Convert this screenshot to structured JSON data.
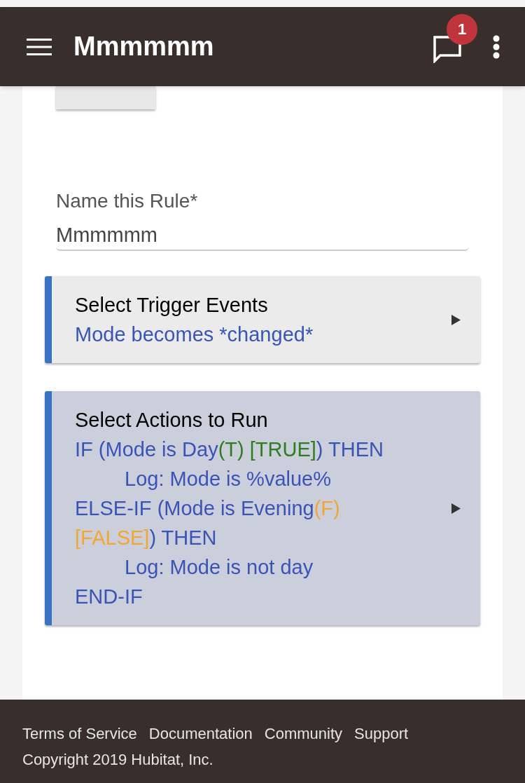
{
  "header": {
    "title": "Mmmmmm",
    "notification_count": "1"
  },
  "name_field": {
    "label": "Name this Rule*",
    "value": "Mmmmmm"
  },
  "sections": [
    {
      "title": "Select Trigger Events",
      "highlighted": false,
      "lines": [
        {
          "indented": false,
          "segments": [
            {
              "text": "Mode becomes *changed*",
              "color": "#3a53b8"
            }
          ]
        }
      ]
    },
    {
      "title": "Select Actions to Run",
      "highlighted": true,
      "lines": [
        {
          "indented": false,
          "segments": [
            {
              "text": "IF (Mode is Day",
              "color": "#3a53b8"
            },
            {
              "text": "(T) [TRUE]",
              "color": "#2e7d1f"
            },
            {
              "text": ") THEN",
              "color": "#3a53b8"
            }
          ]
        },
        {
          "indented": true,
          "segments": [
            {
              "text": "Log: Mode is %value%",
              "color": "#3a53b8"
            }
          ]
        },
        {
          "indented": false,
          "segments": [
            {
              "text": "ELSE-IF (Mode is Evening",
              "color": "#3a53b8"
            },
            {
              "text": "(F)",
              "color": "#f5a530"
            }
          ]
        },
        {
          "indented": false,
          "segments": [
            {
              "text": "[FALSE]",
              "color": "#f5a530"
            },
            {
              "text": ") THEN",
              "color": "#3a53b8"
            }
          ]
        },
        {
          "indented": true,
          "segments": [
            {
              "text": "Log: Mode is not day",
              "color": "#3a53b8"
            }
          ]
        },
        {
          "indented": false,
          "segments": [
            {
              "text": "END-IF",
              "color": "#3a53b8"
            }
          ]
        }
      ]
    }
  ],
  "footer": {
    "links": [
      "Terms of Service",
      "Documentation",
      "Community",
      "Support"
    ],
    "copyright": "Copyright 2019 Hubitat, Inc."
  }
}
